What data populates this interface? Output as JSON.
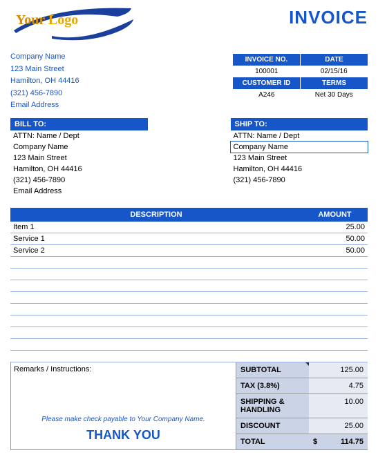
{
  "logo": {
    "line1": "Your",
    "line2": "Logo"
  },
  "title": "INVOICE",
  "company": {
    "name": "Company Name",
    "street": "123 Main Street",
    "citystate": "Hamilton, OH  44416",
    "phone": "(321) 456-7890",
    "email": "Email Address"
  },
  "meta": {
    "invno_label": "INVOICE NO.",
    "invno": "100001",
    "date_label": "DATE",
    "date": "02/15/16",
    "custid_label": "CUSTOMER ID",
    "custid": "A246",
    "terms_label": "TERMS",
    "terms": "Net 30 Days"
  },
  "bill": {
    "hdr": "BILL TO:",
    "attn": "ATTN: Name / Dept",
    "name": "Company Name",
    "street": "123 Main Street",
    "citystate": "Hamilton, OH  44416",
    "phone": "(321) 456-7890",
    "email": "Email Address"
  },
  "ship": {
    "hdr": "SHIP TO:",
    "attn": "ATTN: Name / Dept",
    "name": "Company Name",
    "street": "123 Main Street",
    "citystate": "Hamilton, OH  44416",
    "phone": "(321) 456-7890"
  },
  "cols": {
    "desc": "DESCRIPTION",
    "amt": "AMOUNT"
  },
  "lines": [
    {
      "desc": "Item 1",
      "amt": "25.00"
    },
    {
      "desc": "Service 1",
      "amt": "50.00"
    },
    {
      "desc": "Service 2",
      "amt": "50.00"
    },
    {
      "desc": "",
      "amt": ""
    },
    {
      "desc": "",
      "amt": ""
    },
    {
      "desc": "",
      "amt": ""
    },
    {
      "desc": "",
      "amt": ""
    },
    {
      "desc": "",
      "amt": ""
    },
    {
      "desc": "",
      "amt": ""
    },
    {
      "desc": "",
      "amt": ""
    },
    {
      "desc": "",
      "amt": ""
    },
    {
      "desc": "",
      "amt": ""
    }
  ],
  "remarks": {
    "label": "Remarks / Instructions:",
    "payable": "Please make check payable to Your Company Name.",
    "thanks": "THANK YOU"
  },
  "totals": {
    "subtotal_label": "SUBTOTAL",
    "subtotal": "125.00",
    "tax_label": "TAX (3.8%)",
    "tax": "4.75",
    "ship_label": "SHIPPING & HANDLING",
    "ship": "10.00",
    "disc_label": "DISCOUNT",
    "disc": "25.00",
    "total_label": "TOTAL",
    "total_sym": "$",
    "total": "114.75"
  }
}
